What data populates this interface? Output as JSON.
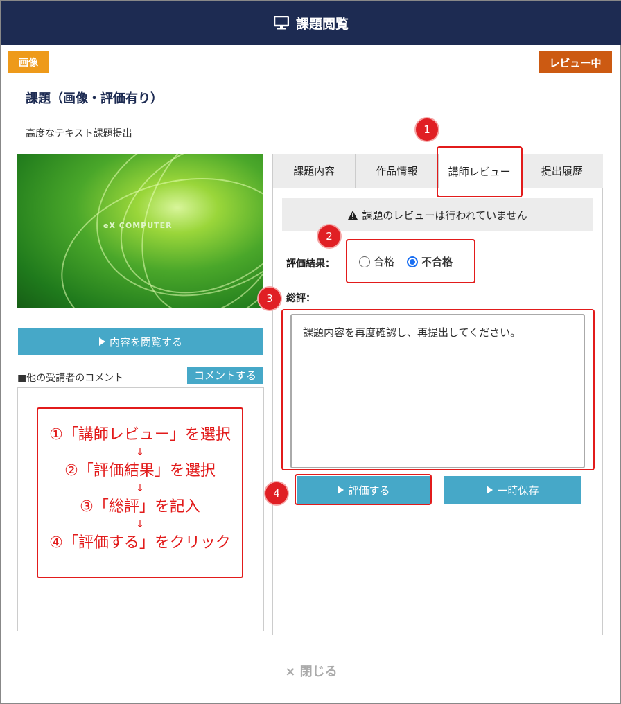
{
  "header": {
    "title": "課題閲覧",
    "icon": "monitor-icon"
  },
  "badges": {
    "type": "画像",
    "status": "レビュー中"
  },
  "assignment": {
    "title": "課題（画像・評価有り）",
    "subtitle": "高度なテキスト課題提出"
  },
  "preview": {
    "brand": "eX COMPUTER"
  },
  "left": {
    "view_button": "内容を閲覧する",
    "comments_label": "■他の受講者のコメント",
    "comment_button": "コメントする"
  },
  "tabs": [
    {
      "label": "課題内容"
    },
    {
      "label": "作品情報"
    },
    {
      "label": "講師レビュー"
    },
    {
      "label": "提出履歴"
    }
  ],
  "review": {
    "notice": "課題のレビューは行われていません",
    "eval_label": "評価結果：",
    "options": [
      {
        "label": "合格",
        "checked": false
      },
      {
        "label": "不合格",
        "checked": true
      }
    ],
    "comment_label": "総評：",
    "comment_text": "課題内容を再度確認し、再提出してください。",
    "eval_button": "評価する",
    "save_button": "一時保存"
  },
  "close_label": "× 閉じる",
  "steps": [
    "①「講師レビュー」を選択",
    "②「評価結果」を選択",
    "③「総評」を記入",
    "④「評価する」をクリック"
  ],
  "step_arrow": "↓",
  "markers": [
    "1",
    "2",
    "3",
    "4"
  ],
  "colors": {
    "header": "#1d2b52",
    "accent": "#46a8c8",
    "type_badge": "#ee9a1a",
    "status_badge": "#cc5a12",
    "annotation": "#e21b1b"
  }
}
